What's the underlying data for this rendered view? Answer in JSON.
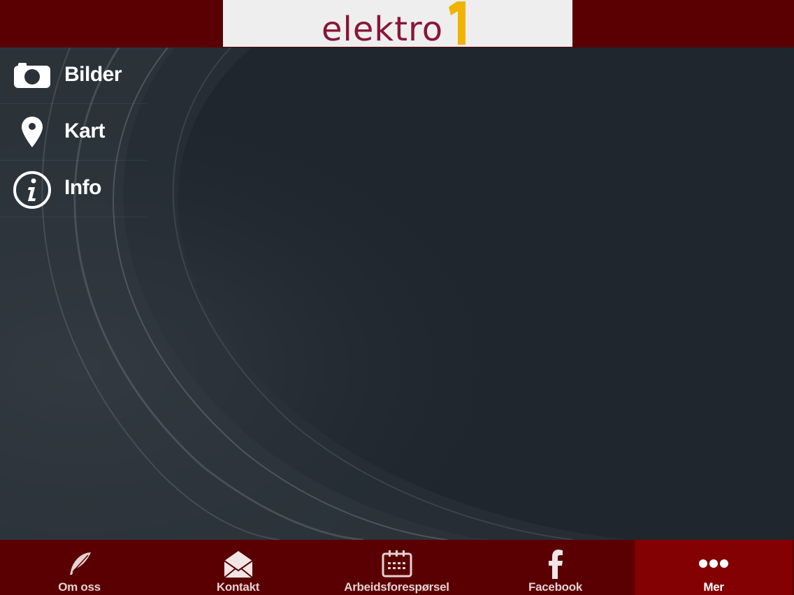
{
  "header": {
    "logo_text": "elektro",
    "logo_number": "1",
    "colors": {
      "bar": "#5a0003",
      "logo_text": "#8a1538",
      "logo_accent": "#f0b400"
    }
  },
  "menu": {
    "items": [
      {
        "label": "Bilder",
        "icon": "camera-icon"
      },
      {
        "label": "Kart",
        "icon": "map-pin-icon"
      },
      {
        "label": "Info",
        "icon": "info-icon"
      }
    ]
  },
  "tabbar": {
    "active_index": 4,
    "tabs": [
      {
        "label": "Om oss",
        "icon": "feather-icon"
      },
      {
        "label": "Kontakt",
        "icon": "envelope-icon"
      },
      {
        "label": "Arbeidsforespørsel",
        "icon": "calendar-icon"
      },
      {
        "label": "Facebook",
        "icon": "facebook-icon"
      },
      {
        "label": "Mer",
        "icon": "more-dots-icon"
      }
    ],
    "colors": {
      "bar": "#5a0003",
      "active": "#830003"
    }
  }
}
